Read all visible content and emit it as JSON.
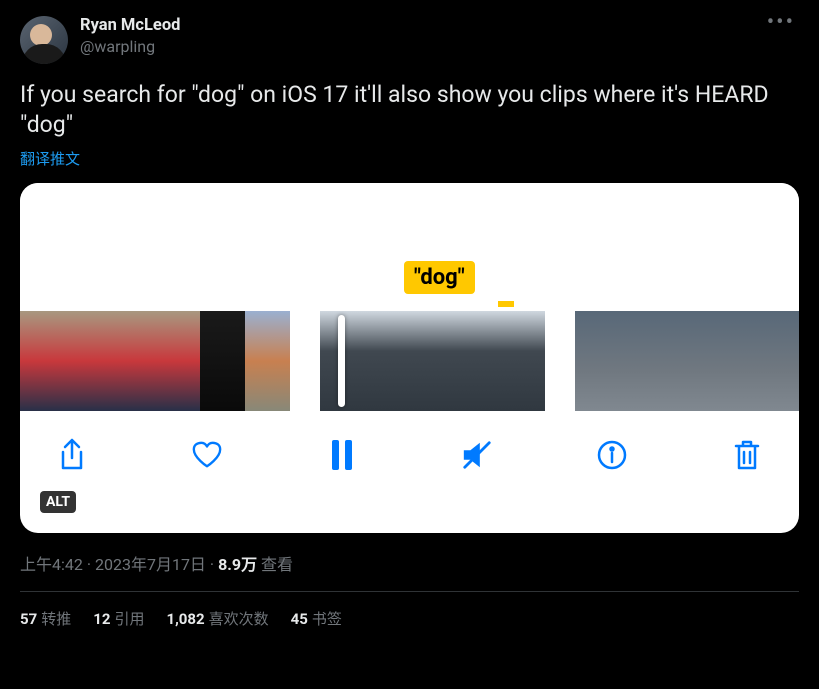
{
  "user": {
    "display_name": "Ryan McLeod",
    "handle": "@warpling"
  },
  "content": {
    "text": "If you search for \"dog\" on iOS 17 it'll also show you clips where it's HEARD \"dog\"",
    "translate_label": "翻译推文"
  },
  "media": {
    "caption_overlay": "\"dog\"",
    "alt_badge": "ALT"
  },
  "meta": {
    "time": "上午4:42",
    "date": "2023年7月17日",
    "views_count": "8.9万",
    "views_label": "查看",
    "separator": " · "
  },
  "stats": {
    "retweets_count": "57",
    "retweets_label": "转推",
    "quotes_count": "12",
    "quotes_label": "引用",
    "likes_count": "1,082",
    "likes_label": "喜欢次数",
    "bookmarks_count": "45",
    "bookmarks_label": "书签"
  }
}
